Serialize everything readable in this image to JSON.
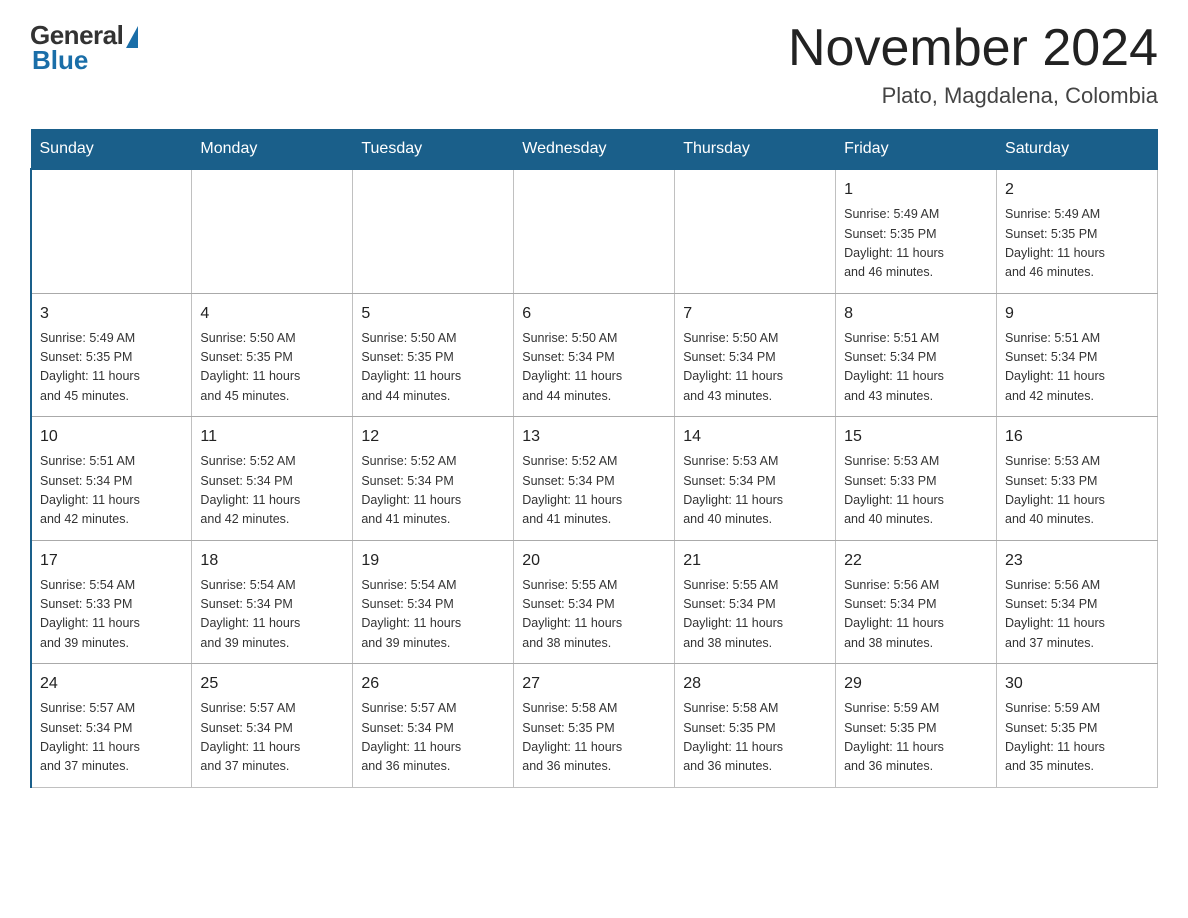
{
  "header": {
    "logo": {
      "general": "General",
      "blue": "Blue"
    },
    "title": "November 2024",
    "subtitle": "Plato, Magdalena, Colombia"
  },
  "days_header": [
    "Sunday",
    "Monday",
    "Tuesday",
    "Wednesday",
    "Thursday",
    "Friday",
    "Saturday"
  ],
  "weeks": [
    [
      {
        "num": "",
        "info": ""
      },
      {
        "num": "",
        "info": ""
      },
      {
        "num": "",
        "info": ""
      },
      {
        "num": "",
        "info": ""
      },
      {
        "num": "",
        "info": ""
      },
      {
        "num": "1",
        "info": "Sunrise: 5:49 AM\nSunset: 5:35 PM\nDaylight: 11 hours\nand 46 minutes."
      },
      {
        "num": "2",
        "info": "Sunrise: 5:49 AM\nSunset: 5:35 PM\nDaylight: 11 hours\nand 46 minutes."
      }
    ],
    [
      {
        "num": "3",
        "info": "Sunrise: 5:49 AM\nSunset: 5:35 PM\nDaylight: 11 hours\nand 45 minutes."
      },
      {
        "num": "4",
        "info": "Sunrise: 5:50 AM\nSunset: 5:35 PM\nDaylight: 11 hours\nand 45 minutes."
      },
      {
        "num": "5",
        "info": "Sunrise: 5:50 AM\nSunset: 5:35 PM\nDaylight: 11 hours\nand 44 minutes."
      },
      {
        "num": "6",
        "info": "Sunrise: 5:50 AM\nSunset: 5:34 PM\nDaylight: 11 hours\nand 44 minutes."
      },
      {
        "num": "7",
        "info": "Sunrise: 5:50 AM\nSunset: 5:34 PM\nDaylight: 11 hours\nand 43 minutes."
      },
      {
        "num": "8",
        "info": "Sunrise: 5:51 AM\nSunset: 5:34 PM\nDaylight: 11 hours\nand 43 minutes."
      },
      {
        "num": "9",
        "info": "Sunrise: 5:51 AM\nSunset: 5:34 PM\nDaylight: 11 hours\nand 42 minutes."
      }
    ],
    [
      {
        "num": "10",
        "info": "Sunrise: 5:51 AM\nSunset: 5:34 PM\nDaylight: 11 hours\nand 42 minutes."
      },
      {
        "num": "11",
        "info": "Sunrise: 5:52 AM\nSunset: 5:34 PM\nDaylight: 11 hours\nand 42 minutes."
      },
      {
        "num": "12",
        "info": "Sunrise: 5:52 AM\nSunset: 5:34 PM\nDaylight: 11 hours\nand 41 minutes."
      },
      {
        "num": "13",
        "info": "Sunrise: 5:52 AM\nSunset: 5:34 PM\nDaylight: 11 hours\nand 41 minutes."
      },
      {
        "num": "14",
        "info": "Sunrise: 5:53 AM\nSunset: 5:34 PM\nDaylight: 11 hours\nand 40 minutes."
      },
      {
        "num": "15",
        "info": "Sunrise: 5:53 AM\nSunset: 5:33 PM\nDaylight: 11 hours\nand 40 minutes."
      },
      {
        "num": "16",
        "info": "Sunrise: 5:53 AM\nSunset: 5:33 PM\nDaylight: 11 hours\nand 40 minutes."
      }
    ],
    [
      {
        "num": "17",
        "info": "Sunrise: 5:54 AM\nSunset: 5:33 PM\nDaylight: 11 hours\nand 39 minutes."
      },
      {
        "num": "18",
        "info": "Sunrise: 5:54 AM\nSunset: 5:34 PM\nDaylight: 11 hours\nand 39 minutes."
      },
      {
        "num": "19",
        "info": "Sunrise: 5:54 AM\nSunset: 5:34 PM\nDaylight: 11 hours\nand 39 minutes."
      },
      {
        "num": "20",
        "info": "Sunrise: 5:55 AM\nSunset: 5:34 PM\nDaylight: 11 hours\nand 38 minutes."
      },
      {
        "num": "21",
        "info": "Sunrise: 5:55 AM\nSunset: 5:34 PM\nDaylight: 11 hours\nand 38 minutes."
      },
      {
        "num": "22",
        "info": "Sunrise: 5:56 AM\nSunset: 5:34 PM\nDaylight: 11 hours\nand 38 minutes."
      },
      {
        "num": "23",
        "info": "Sunrise: 5:56 AM\nSunset: 5:34 PM\nDaylight: 11 hours\nand 37 minutes."
      }
    ],
    [
      {
        "num": "24",
        "info": "Sunrise: 5:57 AM\nSunset: 5:34 PM\nDaylight: 11 hours\nand 37 minutes."
      },
      {
        "num": "25",
        "info": "Sunrise: 5:57 AM\nSunset: 5:34 PM\nDaylight: 11 hours\nand 37 minutes."
      },
      {
        "num": "26",
        "info": "Sunrise: 5:57 AM\nSunset: 5:34 PM\nDaylight: 11 hours\nand 36 minutes."
      },
      {
        "num": "27",
        "info": "Sunrise: 5:58 AM\nSunset: 5:35 PM\nDaylight: 11 hours\nand 36 minutes."
      },
      {
        "num": "28",
        "info": "Sunrise: 5:58 AM\nSunset: 5:35 PM\nDaylight: 11 hours\nand 36 minutes."
      },
      {
        "num": "29",
        "info": "Sunrise: 5:59 AM\nSunset: 5:35 PM\nDaylight: 11 hours\nand 36 minutes."
      },
      {
        "num": "30",
        "info": "Sunrise: 5:59 AM\nSunset: 5:35 PM\nDaylight: 11 hours\nand 35 minutes."
      }
    ]
  ]
}
